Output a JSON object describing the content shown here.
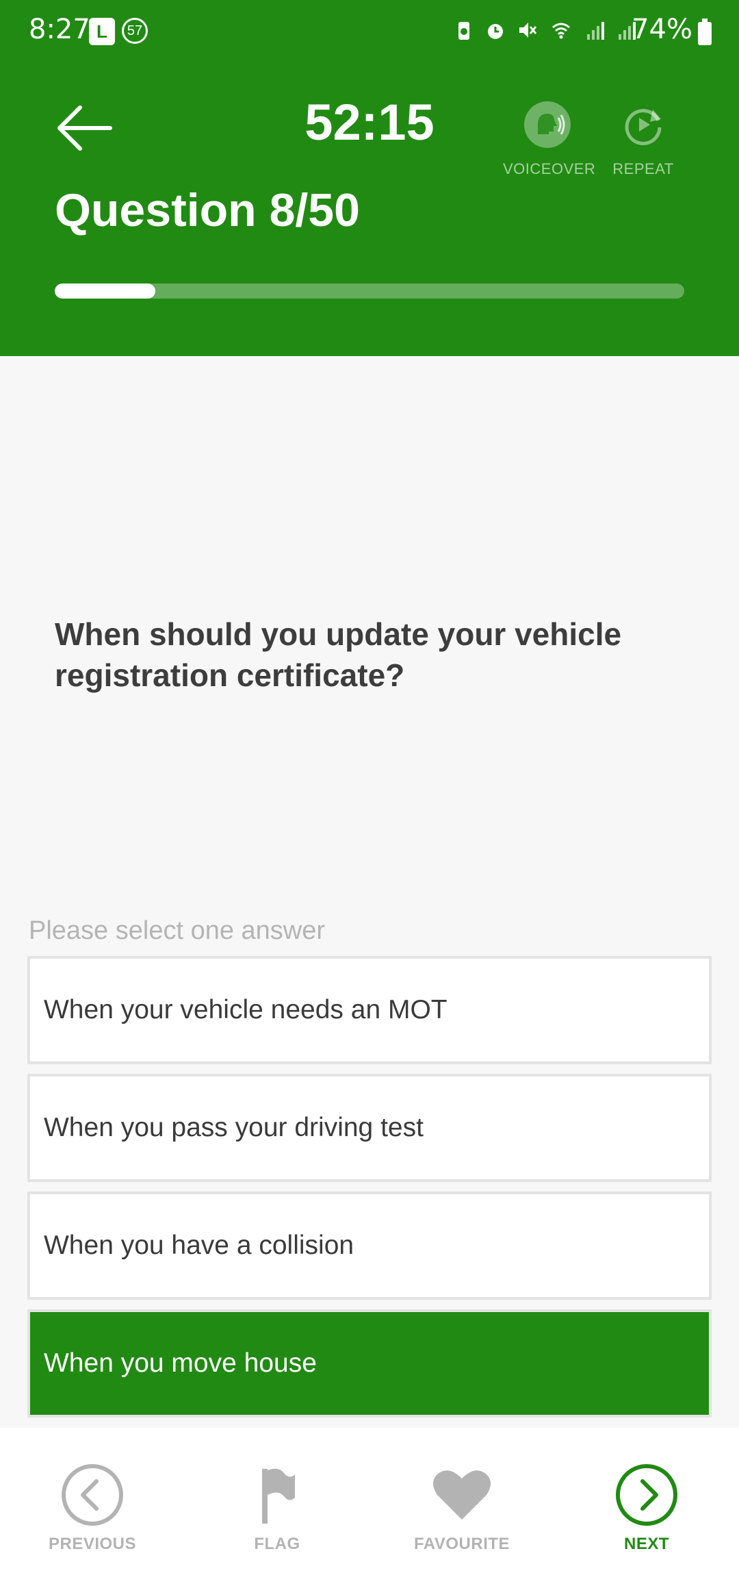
{
  "status": {
    "time": "8:27",
    "app_badge": "L",
    "notif_count": "57",
    "battery": "74%"
  },
  "header": {
    "timer": "52:15",
    "voiceover_label": "VOICEOVER",
    "repeat_label": "REPEAT",
    "question_count": "Question 8/50",
    "progress": 0.16
  },
  "question": {
    "text": "When should you update your vehicle registration certificate?"
  },
  "answers": {
    "prompt": "Please select one answer",
    "items": [
      {
        "label": "When your vehicle needs an MOT",
        "selected": false
      },
      {
        "label": "When you pass your driving test",
        "selected": false
      },
      {
        "label": "When you have a collision",
        "selected": false
      },
      {
        "label": "When you move house",
        "selected": true
      }
    ]
  },
  "nav": {
    "previous": "PREVIOUS",
    "flag": "FLAG",
    "favourite": "FAVOURITE",
    "next": "NEXT"
  },
  "colors": {
    "accent": "#218a13",
    "inactive": "#b3b3b3"
  }
}
